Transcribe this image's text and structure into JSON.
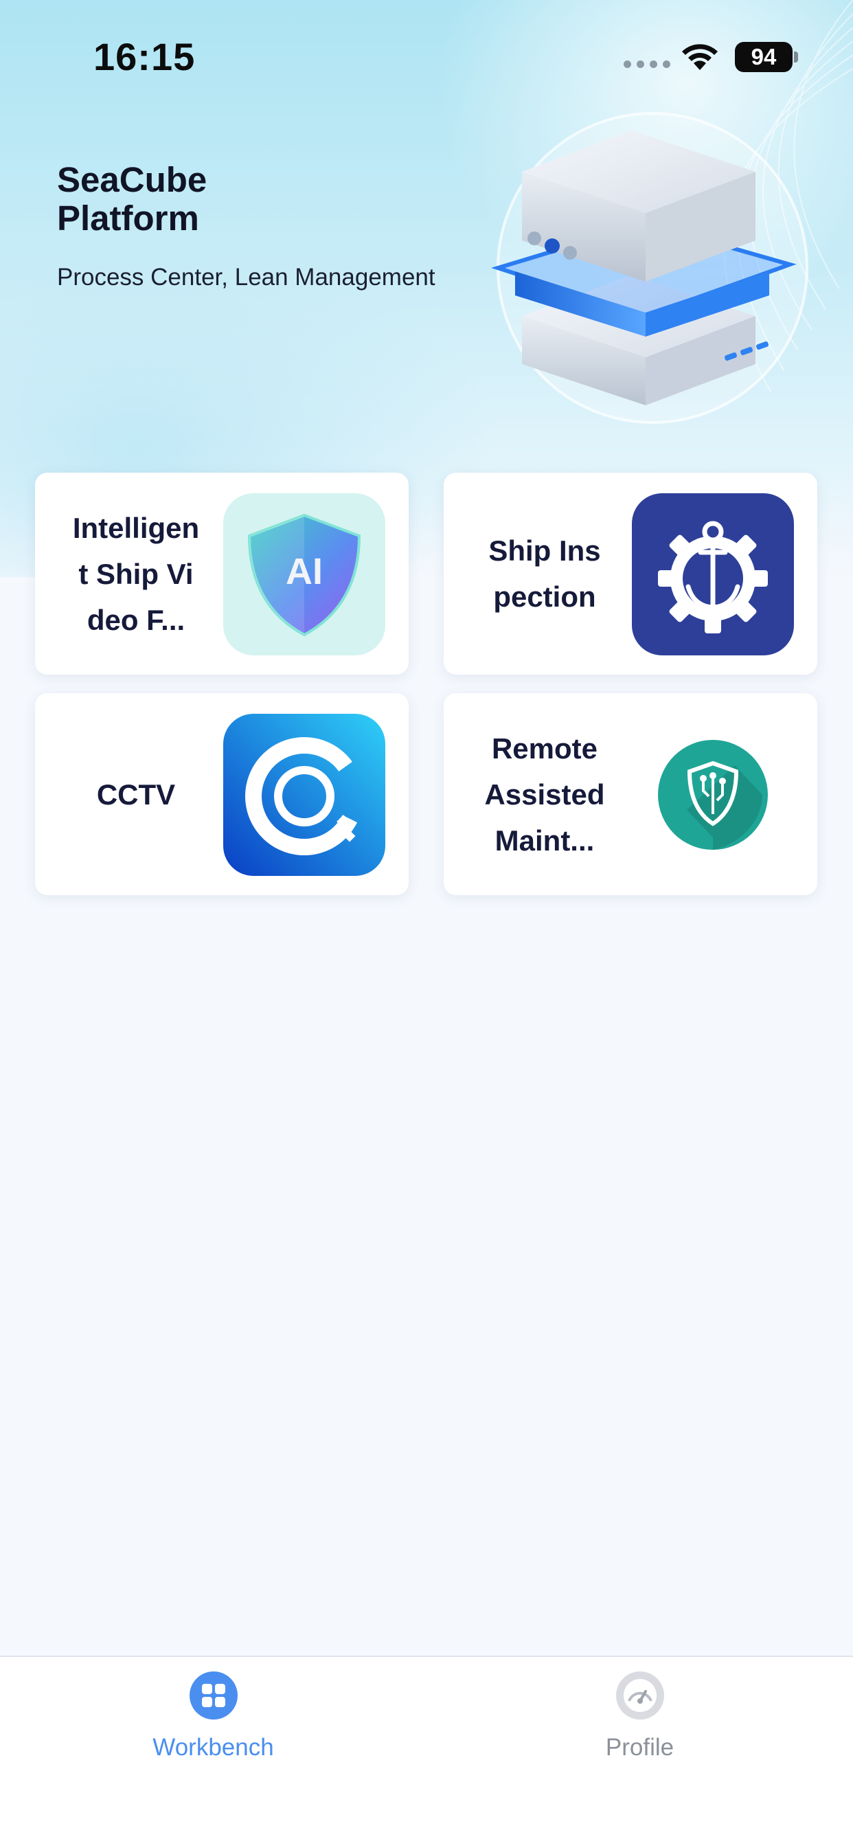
{
  "status_bar": {
    "time": "16:15",
    "battery": "94"
  },
  "header": {
    "title": "SeaCube Platform",
    "subtitle": "Process Center, Lean Management"
  },
  "apps": [
    {
      "label": "Intelligen\nt Ship Vi\ndeo F...",
      "icon": "ai-shield-icon",
      "icon_text": "AI"
    },
    {
      "label": "Ship Ins\npection",
      "icon": "anchor-gear-icon"
    },
    {
      "label": "CCTV",
      "icon": "cctv-camera-icon"
    },
    {
      "label": "Remote\nAssisted\nMaint...",
      "icon": "shield-circuit-icon"
    }
  ],
  "tabbar": {
    "items": [
      {
        "label": "Workbench",
        "icon": "grid-icon",
        "active": true
      },
      {
        "label": "Profile",
        "icon": "gauge-icon",
        "active": false
      }
    ]
  },
  "colors": {
    "accent": "#4a8ef0",
    "inactive_tab": "#8b9099",
    "ship_inspection_bg": "#2e3f99",
    "remote_bg": "#1fa596",
    "ai_bg": "#d5f3f0"
  }
}
